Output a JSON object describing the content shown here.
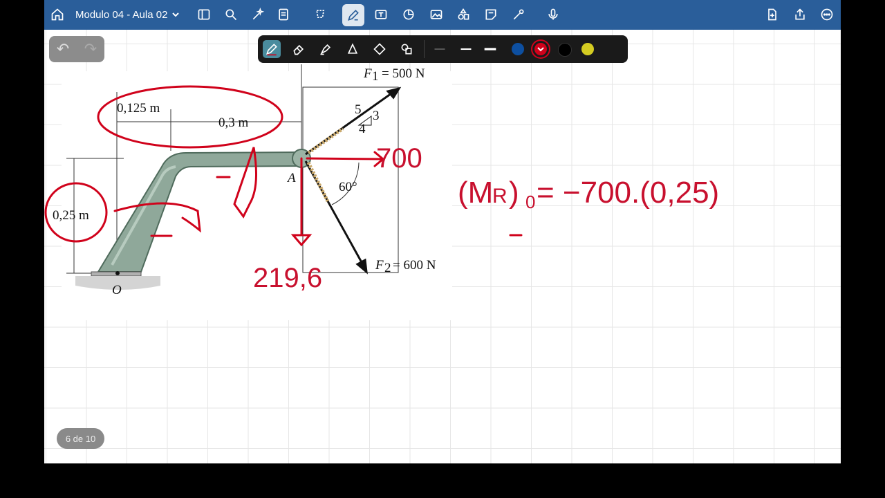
{
  "topbar": {
    "doc_title": "Modulo 04 - Aula 02"
  },
  "page_indicator": "6 de 10",
  "pen_toolbar": {
    "colors": [
      "#0d4fa0",
      "#d0021b",
      "#000000",
      "#d4cc22"
    ]
  },
  "figure": {
    "dim_0125": "0,125 m",
    "dim_03": "0,3 m",
    "dim_025": "0,25 m",
    "label_o": "O",
    "label_a": "A",
    "f1_label": "F",
    "f1_sub": "1",
    "f1_value": "= 500 N",
    "f2_label": "F",
    "f2_sub": "2",
    "f2_value": "= 600 N",
    "slope_5": "5",
    "slope_3": "3",
    "slope_4": "4",
    "angle": "60°"
  },
  "handwriting": {
    "hx": "700",
    "hy": "219,6",
    "equation": "(M",
    "equation_sub": "R",
    "equation_rest": ")",
    "equation_o": "0",
    "equation_rhs": "= −700.(0,25)"
  }
}
